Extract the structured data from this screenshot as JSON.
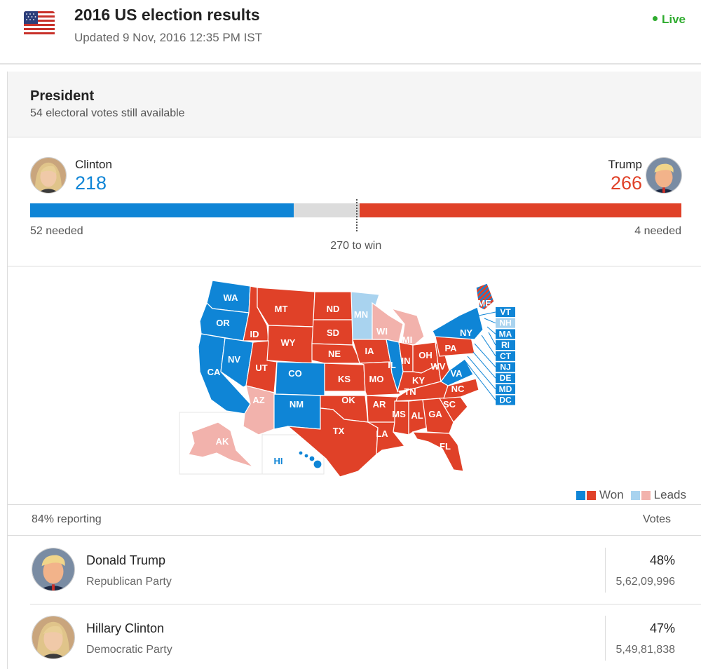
{
  "header": {
    "flag_icon": "us-flag-icon",
    "title": "2016 US election results",
    "updated": "Updated 9 Nov, 2016 12:35 PM IST",
    "live_label": "Live"
  },
  "colors": {
    "won_dem": "#0f85d6",
    "won_rep": "#e04128",
    "lead_dem": "#a9d3ef",
    "lead_rep": "#f2b2ac",
    "live": "#2eab2e"
  },
  "president": {
    "title": "President",
    "subtitle": "54 electoral votes still available",
    "clinton": {
      "name": "Clinton",
      "votes": "218",
      "needed": "52 needed"
    },
    "trump": {
      "name": "Trump",
      "votes": "266",
      "needed": "4 needed"
    },
    "to_win": "270 to win",
    "electoral": {
      "dem": 218,
      "rep": 266,
      "total": 538,
      "threshold": 270
    }
  },
  "map": {
    "states": [
      {
        "code": "WA",
        "status": "won_dem"
      },
      {
        "code": "OR",
        "status": "won_dem"
      },
      {
        "code": "CA",
        "status": "won_dem"
      },
      {
        "code": "NV",
        "status": "won_dem"
      },
      {
        "code": "ID",
        "status": "won_rep"
      },
      {
        "code": "MT",
        "status": "won_rep"
      },
      {
        "code": "WY",
        "status": "won_rep"
      },
      {
        "code": "UT",
        "status": "won_rep"
      },
      {
        "code": "AZ",
        "status": "lead_rep"
      },
      {
        "code": "CO",
        "status": "won_dem"
      },
      {
        "code": "NM",
        "status": "won_dem"
      },
      {
        "code": "ND",
        "status": "won_rep"
      },
      {
        "code": "SD",
        "status": "won_rep"
      },
      {
        "code": "NE",
        "status": "won_rep"
      },
      {
        "code": "KS",
        "status": "won_rep"
      },
      {
        "code": "OK",
        "status": "won_rep"
      },
      {
        "code": "TX",
        "status": "won_rep"
      },
      {
        "code": "MN",
        "status": "lead_dem"
      },
      {
        "code": "IA",
        "status": "won_rep"
      },
      {
        "code": "MO",
        "status": "won_rep"
      },
      {
        "code": "AR",
        "status": "won_rep"
      },
      {
        "code": "LA",
        "status": "won_rep"
      },
      {
        "code": "WI",
        "status": "lead_rep"
      },
      {
        "code": "IL",
        "status": "won_dem"
      },
      {
        "code": "MI",
        "status": "lead_rep"
      },
      {
        "code": "IN",
        "status": "won_rep"
      },
      {
        "code": "OH",
        "status": "won_rep"
      },
      {
        "code": "KY",
        "status": "won_rep"
      },
      {
        "code": "TN",
        "status": "won_rep"
      },
      {
        "code": "MS",
        "status": "won_rep"
      },
      {
        "code": "AL",
        "status": "won_rep"
      },
      {
        "code": "GA",
        "status": "won_rep"
      },
      {
        "code": "FL",
        "status": "won_rep"
      },
      {
        "code": "SC",
        "status": "won_rep"
      },
      {
        "code": "NC",
        "status": "won_rep"
      },
      {
        "code": "VA",
        "status": "won_dem"
      },
      {
        "code": "WV",
        "status": "won_rep"
      },
      {
        "code": "PA",
        "status": "won_rep"
      },
      {
        "code": "NY",
        "status": "won_dem"
      },
      {
        "code": "ME",
        "status": "split"
      },
      {
        "code": "AK",
        "status": "lead_rep"
      },
      {
        "code": "HI",
        "status": "won_dem"
      },
      {
        "code": "VT",
        "status": "won_dem"
      },
      {
        "code": "NH",
        "status": "lead_dem"
      },
      {
        "code": "MA",
        "status": "won_dem"
      },
      {
        "code": "RI",
        "status": "won_dem"
      },
      {
        "code": "CT",
        "status": "won_dem"
      },
      {
        "code": "NJ",
        "status": "won_dem"
      },
      {
        "code": "DE",
        "status": "won_dem"
      },
      {
        "code": "MD",
        "status": "won_dem"
      },
      {
        "code": "DC",
        "status": "won_dem"
      }
    ],
    "legend": {
      "won": "Won",
      "leads": "Leads"
    }
  },
  "reporting": {
    "percent": "84% reporting",
    "votes_header": "Votes",
    "candidates": [
      {
        "name": "Donald Trump",
        "party": "Republican Party",
        "pct": "48%",
        "votes": "5,62,09,996"
      },
      {
        "name": "Hillary Clinton",
        "party": "Democratic Party",
        "pct": "47%",
        "votes": "5,49,81,838"
      }
    ]
  }
}
